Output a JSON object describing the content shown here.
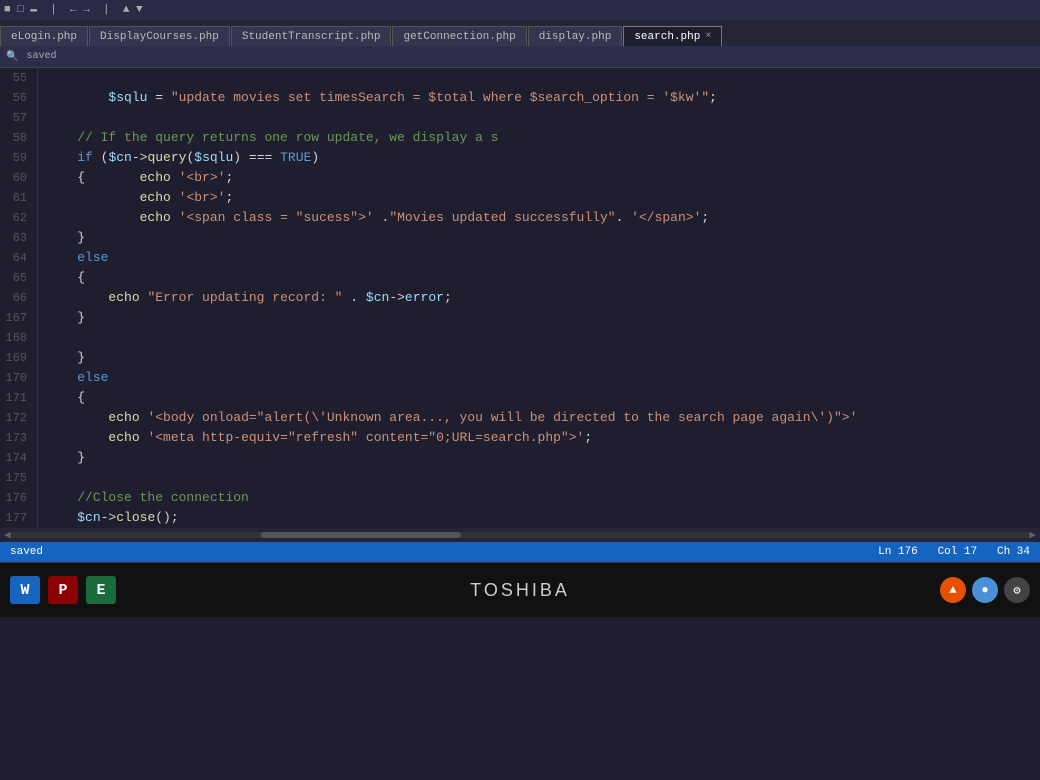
{
  "window": {
    "title": "search.php"
  },
  "tabs": [
    {
      "id": "elogin",
      "label": "eLogin.php",
      "active": false
    },
    {
      "id": "displaycourses",
      "label": "DisplayCourses.php",
      "active": false
    },
    {
      "id": "studenttranscript",
      "label": "StudentTranscript.php",
      "active": false
    },
    {
      "id": "getconnection",
      "label": "getConnection.php",
      "active": false
    },
    {
      "id": "display",
      "label": "display.php",
      "active": false
    },
    {
      "id": "search",
      "label": "search.php",
      "active": true,
      "closeable": true
    }
  ],
  "code": {
    "lines": [
      {
        "num": "55",
        "content": ""
      },
      {
        "num": "56",
        "content": "        $sqlu = \"update movies set timesSearch = $total where $search_option = '$kw'\";",
        "html": true
      },
      {
        "num": "57",
        "content": ""
      },
      {
        "num": "58",
        "content": "    // If the query returns one row update, we display a s"
      },
      {
        "num": "59",
        "content": "    if ($cn->query($sqlu) === TRUE)"
      },
      {
        "num": "60",
        "content": "    {       echo '<br>';"
      },
      {
        "num": "61",
        "content": "            echo '<br>';"
      },
      {
        "num": "62",
        "content": "            echo '<span class = \"sucess\">' .\"Movies updated successfully\". '</span>';"
      },
      {
        "num": "63",
        "content": "    }"
      },
      {
        "num": "64",
        "content": "    else"
      },
      {
        "num": "65",
        "content": "    {"
      },
      {
        "num": "66",
        "content": "        echo \"Error updating record: \" . $cn->error;"
      },
      {
        "num": "167",
        "content": "    }"
      },
      {
        "num": "168",
        "content": ""
      },
      {
        "num": "169",
        "content": "    }"
      },
      {
        "num": "170",
        "content": "    else"
      },
      {
        "num": "171",
        "content": "    {"
      },
      {
        "num": "172",
        "content": "        echo '<body onload=\"alert(\\'Unknown area..., you will be directed to the search page again\\')\">'"
      },
      {
        "num": "173",
        "content": "        echo '<meta http-equiv=\"refresh\" content=\"0;URL=search.php\">';"
      },
      {
        "num": "174",
        "content": "    }"
      },
      {
        "num": "175",
        "content": ""
      },
      {
        "num": "176",
        "content": "    //Close the connection"
      },
      {
        "num": "177",
        "content": "    $cn->close();"
      }
    ]
  },
  "status_bar": {
    "left": "saved",
    "ln": "Ln 176",
    "col": "Col 17",
    "ch": "Ch 34"
  },
  "taskbar": {
    "brand": "TOSHIBA"
  }
}
